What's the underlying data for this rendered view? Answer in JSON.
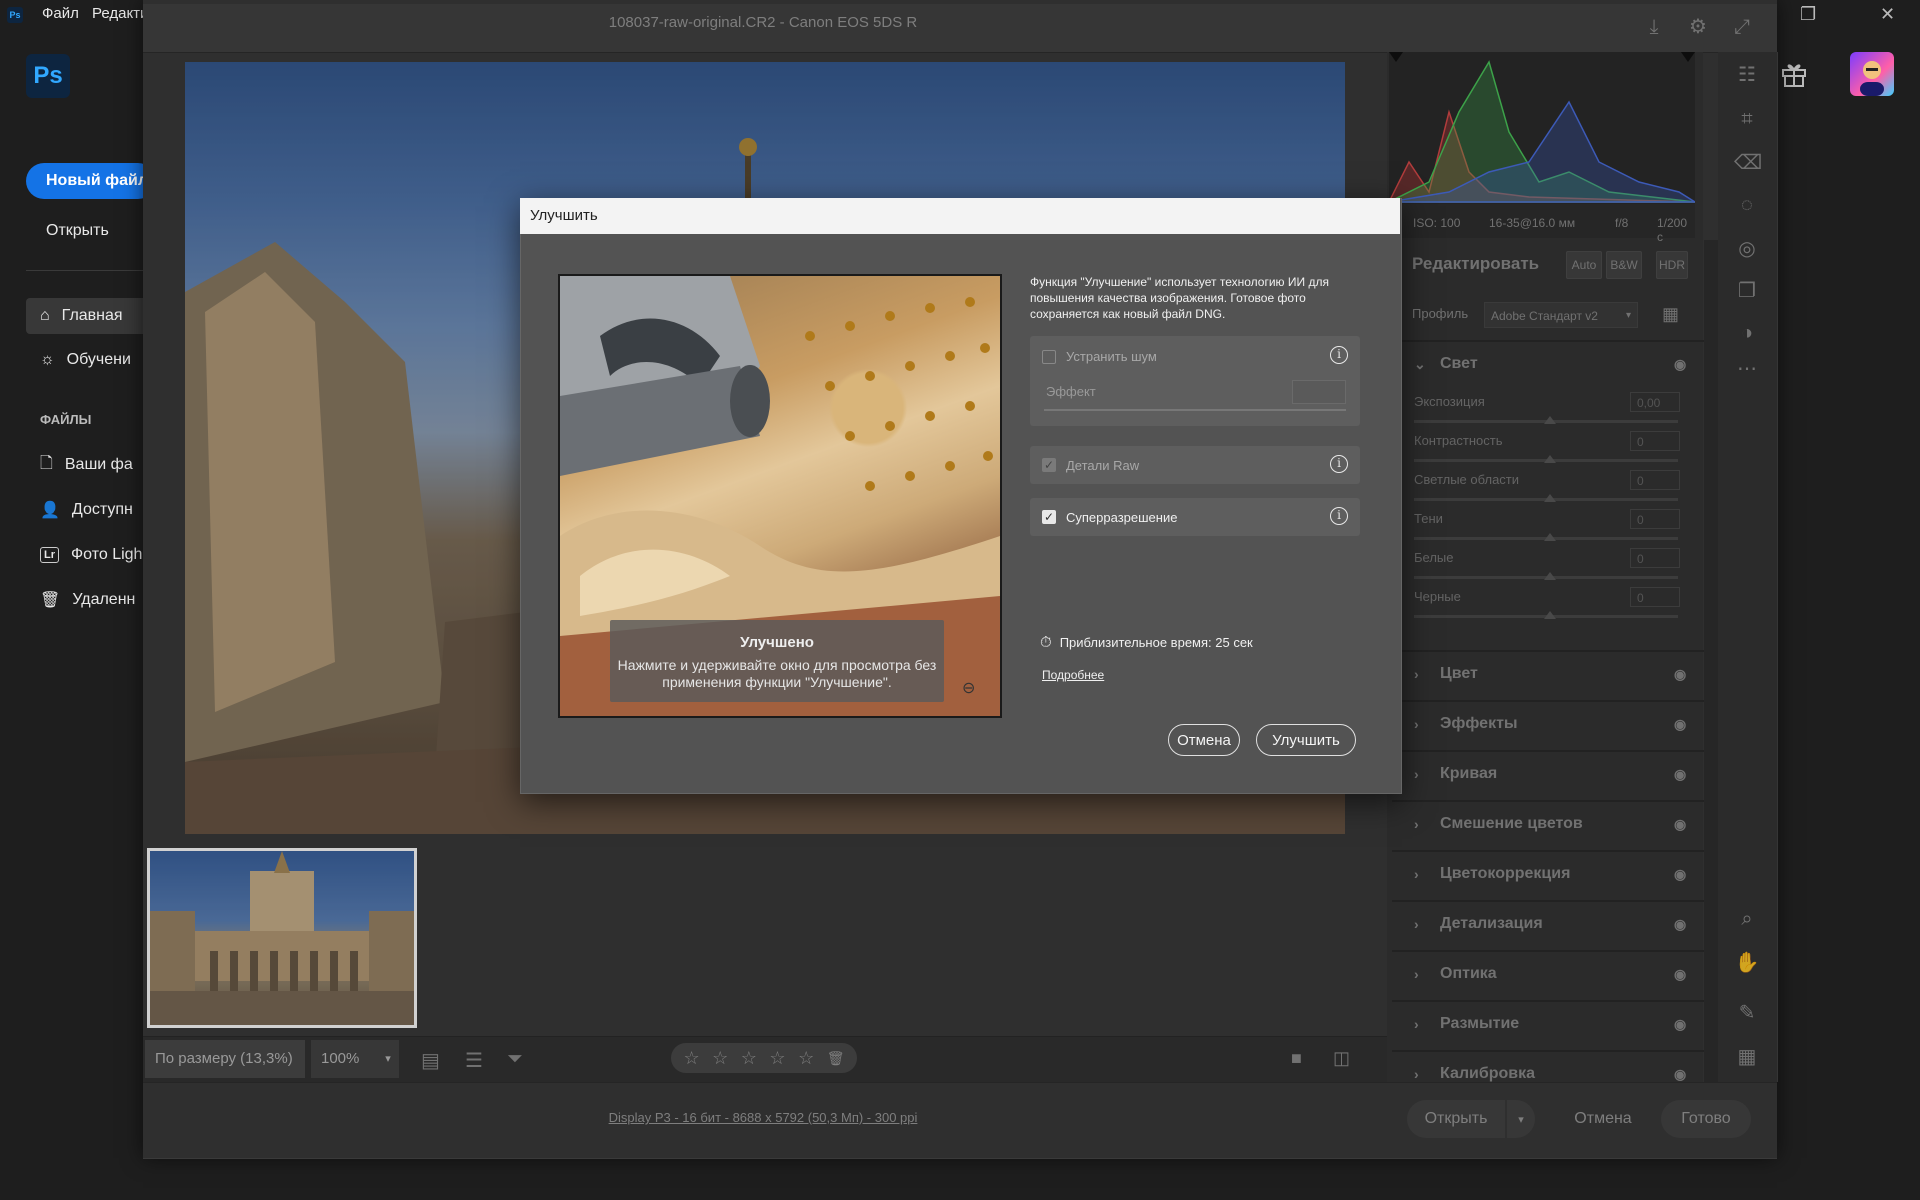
{
  "photoshop": {
    "menu": [
      "Файл",
      "Редакти"
    ],
    "logo": "Ps",
    "mini_logo": "Ps",
    "new_file": "Новый файл",
    "open": "Открыть",
    "nav": [
      {
        "label": "Главная",
        "icon": "home-icon"
      },
      {
        "label": "Обучени",
        "icon": "lightbulb-icon"
      }
    ],
    "files_header": "ФАЙЛЫ",
    "files": [
      {
        "label": "Ваши фа",
        "icon": "file-icon"
      },
      {
        "label": "Доступн",
        "icon": "user-icon"
      },
      {
        "label": "Фото Ligh",
        "icon": "lightroom-icon",
        "badge": "Lr"
      },
      {
        "label": "Удаленн",
        "icon": "trash-icon"
      }
    ]
  },
  "camera_raw": {
    "title": "108037-raw-original.CR2  -  Canon EOS 5DS R",
    "zoom_fit": "По размеру (13,3%)",
    "zoom_pct": "100%",
    "footer_info": "Display P3 - 16 бит - 8688 x 5792 (50,3 Мп) - 300 ppi",
    "footer_buttons": {
      "open": "Открыть",
      "cancel": "Отмена",
      "done": "Готово"
    },
    "exif": {
      "iso": "ISO: 100",
      "lens": "16-35@16.0 мм",
      "aperture": "f/8",
      "shutter": "1/200 с"
    },
    "edit_header": "Редактировать",
    "mode_buttons": [
      "Auto",
      "B&W",
      "HDR"
    ],
    "profile_label": "Профиль",
    "profile_value": "Adobe Стандарт v2",
    "light_section": "Свет",
    "light_sliders": [
      {
        "label": "Экспозиция",
        "value": "0,00"
      },
      {
        "label": "Контрастность",
        "value": "0"
      },
      {
        "label": "Светлые области",
        "value": "0"
      },
      {
        "label": "Тени",
        "value": "0"
      },
      {
        "label": "Белые",
        "value": "0"
      },
      {
        "label": "Черные",
        "value": "0"
      }
    ],
    "sections": [
      "Цвет",
      "Эффекты",
      "Кривая",
      "Смешение цветов",
      "Цветокоррекция",
      "Детализация",
      "Оптика",
      "Размытие",
      "Калибровка"
    ],
    "rating_stars": 0
  },
  "dialog": {
    "title": "Улучшить",
    "description": "Функция \"Улучшение\" использует технологию ИИ для повышения качества изображения. Готовое фото сохраняется как новый файл DNG.",
    "options": {
      "denoise": {
        "label": "Устранить шум",
        "checked": false
      },
      "effect_label": "Эффект",
      "raw_details": {
        "label": "Детали Raw",
        "checked": true
      },
      "super_res": {
        "label": "Суперразрешение",
        "checked": true
      }
    },
    "tip_title": "Улучшено",
    "tip_text": "Нажмите и удерживайте окно для просмотра без применения функции \"Улучшение\".",
    "time_label": "Приблизительное время: 25 сек",
    "learn_more": "Подробнее",
    "cancel": "Отмена",
    "enhance": "Улучшить"
  },
  "colors": {
    "accent": "#1473e6",
    "ps_blue": "#31a8ff"
  }
}
